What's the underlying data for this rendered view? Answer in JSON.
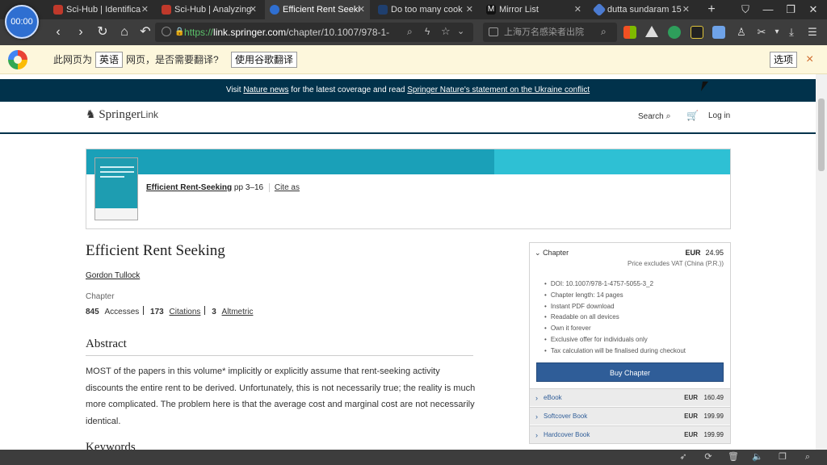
{
  "tabs": [
    {
      "label": "Sci-Hub | Identifica",
      "active": false
    },
    {
      "label": "Sci-Hub | Analyzing",
      "active": false
    },
    {
      "label": "Efficient Rent Seeki",
      "active": true
    },
    {
      "label": "Do too many cook",
      "active": false
    },
    {
      "label": "Mirror List",
      "active": false
    },
    {
      "label": "dutta sundaram 15",
      "active": false
    }
  ],
  "new_tab": "+",
  "timer": "00:00",
  "url": {
    "scheme": "https://",
    "host": "link.springer.com",
    "path": "/chapter/10.1007/978-1-"
  },
  "search_box": {
    "placeholder": "上海万名感染者出院"
  },
  "translate_bar": {
    "prefix": "此网页为",
    "language": "英语",
    "question": "网页，是否需要翻译?",
    "translate_button": "使用谷歌翻译",
    "options_button": "选项",
    "close": "×"
  },
  "banner": {
    "part1": "Visit ",
    "link1": "Nature news",
    "part2": " for the latest coverage and read ",
    "link2": "Springer Nature's statement on the Ukraine conflict"
  },
  "header": {
    "logo_main": "Springer",
    "logo_sub": "Link",
    "search": "Search",
    "login": "Log in"
  },
  "book_card": {
    "title": "Efficient Rent-Seeking",
    "pages": "pp 3–16",
    "cite": "Cite as"
  },
  "article": {
    "title": "Efficient Rent Seeking",
    "author": "Gordon Tullock",
    "type": "Chapter",
    "accesses_num": "845",
    "accesses_label": "Accesses",
    "citations_num": "173",
    "citations_label": "Citations",
    "altmetric_num": "3",
    "altmetric_label": "Altmetric",
    "abstract_heading": "Abstract",
    "abstract_text": "MOST of the papers in this volume* implicitly or explicitly assume that rent-seeking activity discounts the entire rent to be derived. Unfortunately, this is not necessarily true; the reality is much more complicated. The problem here is that the average cost and marginal cost are not necessarily identical.",
    "keywords_heading": "Keywords"
  },
  "purchase": {
    "heading": "Chapter",
    "currency": "EUR",
    "price": "24.95",
    "vat": "Price excludes VAT (China (P.R.))",
    "features": [
      "DOI: 10.1007/978-1-4757-5055-3_2",
      "Chapter length: 14 pages",
      "Instant PDF download",
      "Readable on all devices",
      "Own it forever",
      "Exclusive offer for individuals only",
      "Tax calculation will be finalised during checkout"
    ],
    "buy_label": "Buy Chapter",
    "formats": [
      {
        "name": "eBook",
        "currency": "EUR",
        "price": "160.49"
      },
      {
        "name": "Softcover Book",
        "currency": "EUR",
        "price": "199.99"
      },
      {
        "name": "Hardcover Book",
        "currency": "EUR",
        "price": "199.99"
      }
    ]
  },
  "colors": {
    "springer_navy": "#01324b",
    "card_teal": "#1aa0b8",
    "buy_blue": "#2f5d98",
    "translate_bar_bg": "#fdf7dc"
  }
}
